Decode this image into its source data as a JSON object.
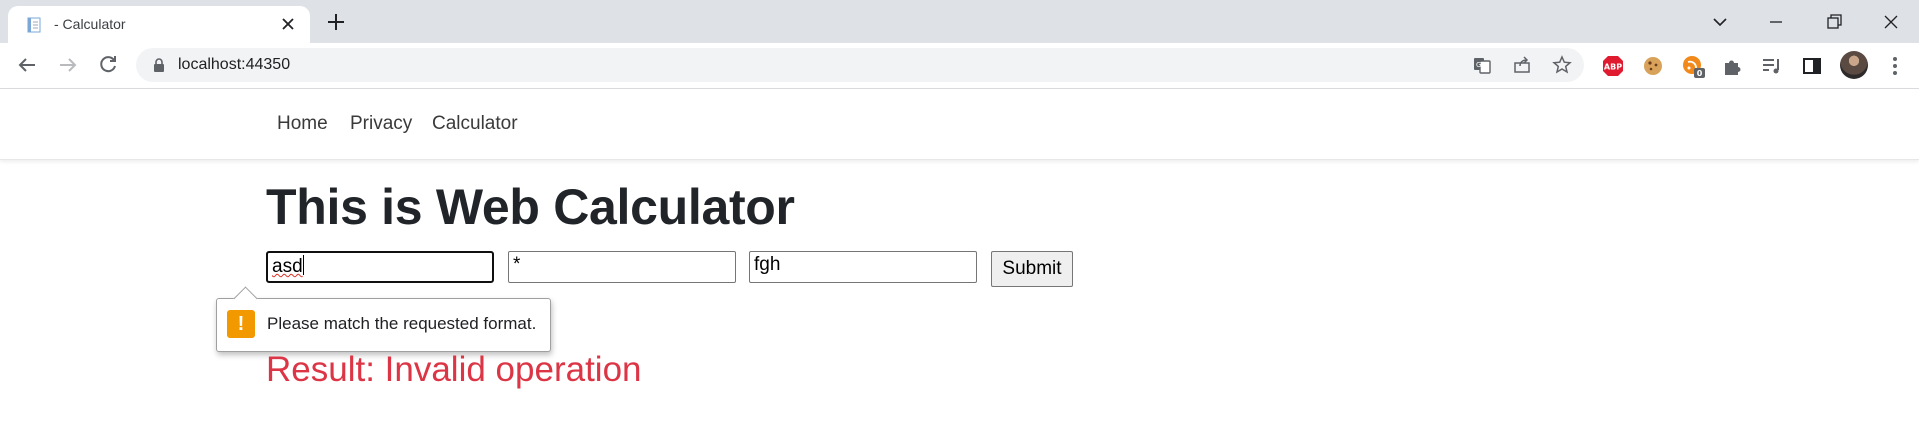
{
  "browser": {
    "tab_title": "- Calculator",
    "url": "localhost:44350",
    "extensions": [
      {
        "name": "adblock-plus-icon",
        "label": "ABP",
        "color": "#e01a2f"
      },
      {
        "name": "cookie-icon",
        "color": "#c8964d"
      },
      {
        "name": "notification-extension-icon",
        "badge": "0",
        "color": "#f28a1b"
      },
      {
        "name": "puzzle-icon"
      },
      {
        "name": "reading-list-icon"
      },
      {
        "name": "side-panel-icon"
      }
    ]
  },
  "nav": {
    "links": [
      "Home",
      "Privacy",
      "Calculator"
    ]
  },
  "main": {
    "heading": "This is Web Calculator",
    "inputs": {
      "first_value": "asd",
      "operator_value": "*",
      "second_value": "fgh"
    },
    "submit_label": "Submit",
    "validation_message": "Please match the requested format.",
    "validation_icon": "!",
    "result": "Result: Invalid operation"
  },
  "colors": {
    "result": "#dc3545",
    "warning": "#f29900"
  }
}
